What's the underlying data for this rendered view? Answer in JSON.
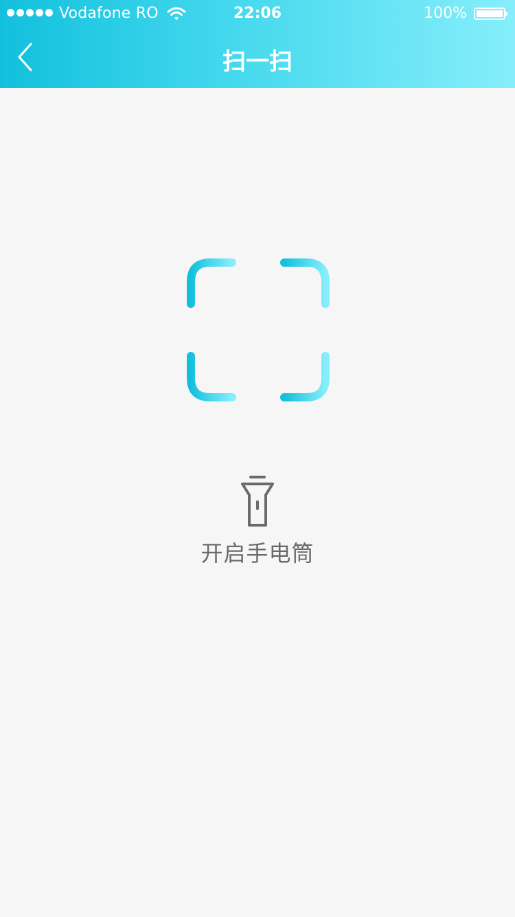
{
  "status_bar": {
    "carrier": "Vodafone RO",
    "time": "22:06",
    "battery_percent": "100%",
    "battery_level": 1.0
  },
  "nav": {
    "title": "扫一扫",
    "back_icon": "chevron-left-icon"
  },
  "scanner": {
    "icon": "scan-frame-icon",
    "gradient_start": "#12c0dd",
    "gradient_end": "#86eefb"
  },
  "flashlight": {
    "icon": "flashlight-icon",
    "label": "开启手电筒",
    "color": "#6a6a6a"
  },
  "colors": {
    "background": "#f6f6f6",
    "header_start": "#12c0dd",
    "header_end": "#86eefb",
    "header_text": "#ffffff"
  }
}
